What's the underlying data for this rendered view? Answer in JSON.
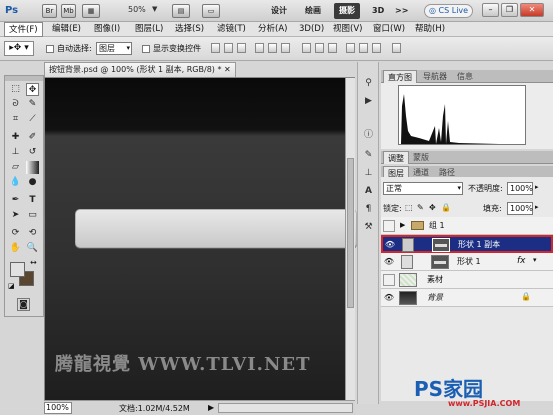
{
  "titlebar": {
    "app_logo": "Ps",
    "br": "Br",
    "mb": "Mb",
    "zoom": "50%",
    "workspaces": [
      "设计",
      "绘画",
      "摄影",
      "3D",
      ">>"
    ],
    "active_workspace": "摄影",
    "cslive": "CS Live"
  },
  "menu": {
    "items": [
      "文件(F)",
      "编辑(E)",
      "图像(I)",
      "图层(L)",
      "选择(S)",
      "滤镜(T)",
      "分析(A)",
      "3D(D)",
      "视图(V)",
      "窗口(W)",
      "帮助(H)"
    ]
  },
  "options": {
    "auto_select_label": "自动选择:",
    "auto_select_value": "图层",
    "show_transform_label": "显示变换控件"
  },
  "document": {
    "tab_title": "按钮背景.psd @ 100% (形状 1 副本, RGB/8) *",
    "watermark": "腾龍視覺 WWW.TLVI.NET",
    "status_zoom": "100%",
    "status_doc": "文档:1.02M/4.52M"
  },
  "panels": {
    "histogram_tabs": [
      "直方图",
      "导航器",
      "信息"
    ],
    "adjust_tabs": [
      "调整",
      "蒙版"
    ],
    "layer_tabs": [
      "图层",
      "通道",
      "路径"
    ],
    "blend_mode": "正常",
    "opacity_label": "不透明度:",
    "opacity_value": "100%",
    "lock_label": "锁定:",
    "fill_label": "填充:",
    "fill_value": "100%"
  },
  "layers": [
    {
      "name": "组 1",
      "selected": false
    },
    {
      "name": "形状 1 副本",
      "selected": true
    },
    {
      "name": "形状 1",
      "selected": false
    },
    {
      "name": "素材",
      "selected": false
    },
    {
      "name": "背景",
      "selected": false
    }
  ],
  "branding": {
    "logo": "PS家园",
    "url": "www.PSJIA.COM"
  },
  "colors": {
    "selected_layer": "#1b2e83",
    "highlight_border": "#d0262c",
    "logo_red": "#d0262c",
    "logo_blue": "#1a5fb4"
  }
}
